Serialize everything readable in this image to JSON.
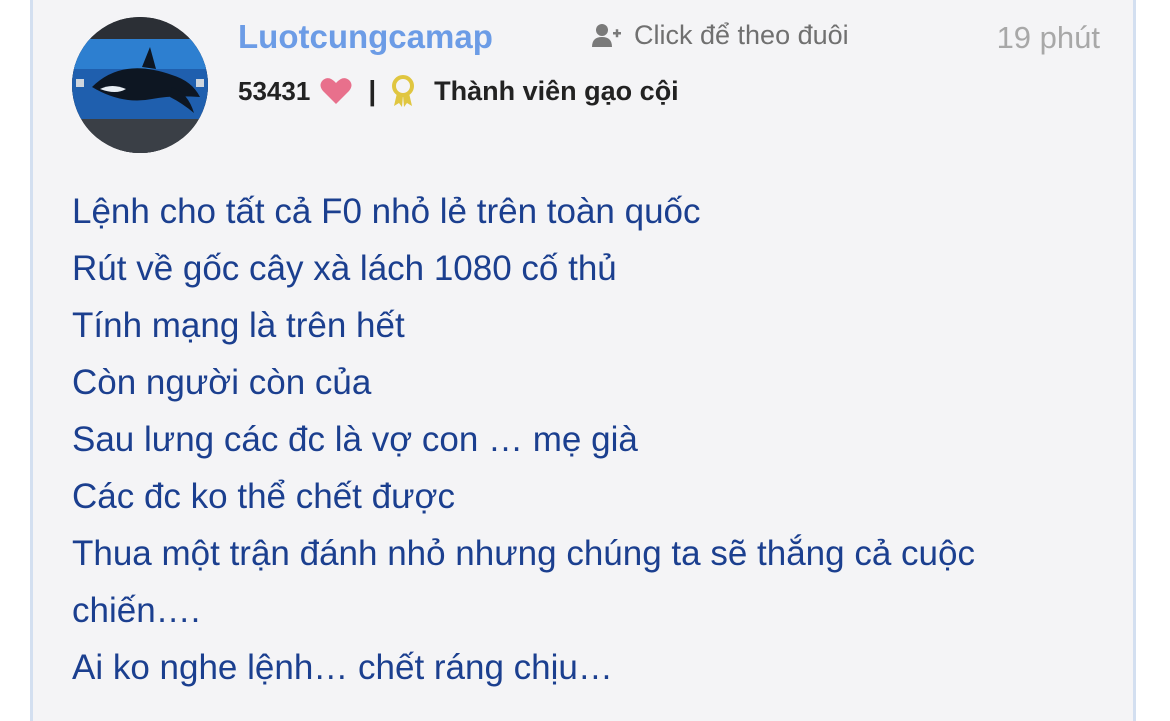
{
  "post": {
    "username": "Luotcungcamap",
    "follow_label": "Click để theo đuôi",
    "time": "19 phút",
    "points": "53431",
    "separator": "|",
    "rank": "Thành viên gạo cội",
    "lines": [
      "Lệnh cho tất cả F0 nhỏ lẻ trên toàn quốc",
      "Rút về gốc cây xà lách 1080 cố thủ",
      "Tính mạng là trên hết",
      "Còn người còn của",
      "Sau lưng các đc là vợ con … mẹ già",
      "Các đc ko thể chết được",
      "Thua một trận đánh nhỏ nhưng chúng ta sẽ thắng cả cuộc chiến….",
      "Ai ko nghe lệnh… chết ráng chịu…"
    ]
  },
  "icons": {
    "avatar": "orca-avatar",
    "follow": "add-user-icon",
    "heart": "heart-icon",
    "badge": "award-ribbon-icon"
  },
  "colors": {
    "username": "#6c9ce6",
    "content_text": "#1b3f8f",
    "heart": "#e8708c",
    "badge": "#e0c640",
    "background": "#f4f4f6"
  }
}
